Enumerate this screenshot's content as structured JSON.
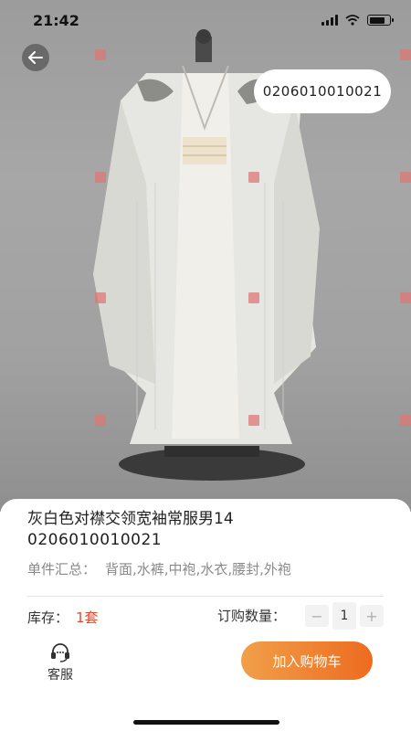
{
  "status_bar": {
    "time": "21:42",
    "signal_icon": "signal-icon",
    "wifi_icon": "wifi-icon",
    "battery_icon": "battery-icon"
  },
  "header": {
    "back_icon": "back-arrow-icon",
    "code_badge": "0206010010021"
  },
  "product": {
    "name": "灰白色对襟交领宽袖常服男14",
    "code": "0206010010021",
    "summary_label": "单件汇总：",
    "summary_items": "背面,水裤,中袍,水衣,腰封,外袍"
  },
  "stock": {
    "label": "库存：",
    "value": "1套"
  },
  "quantity": {
    "label": "订购数量：",
    "minus": "−",
    "value": "1",
    "plus": "+"
  },
  "actions": {
    "service_label": "客服",
    "service_icon": "headset-icon",
    "add_to_cart": "加入购物车"
  },
  "colors": {
    "accent": "#ee6b1f",
    "stock_value": "#e04a2f",
    "accent_light": "#f0a04a"
  }
}
